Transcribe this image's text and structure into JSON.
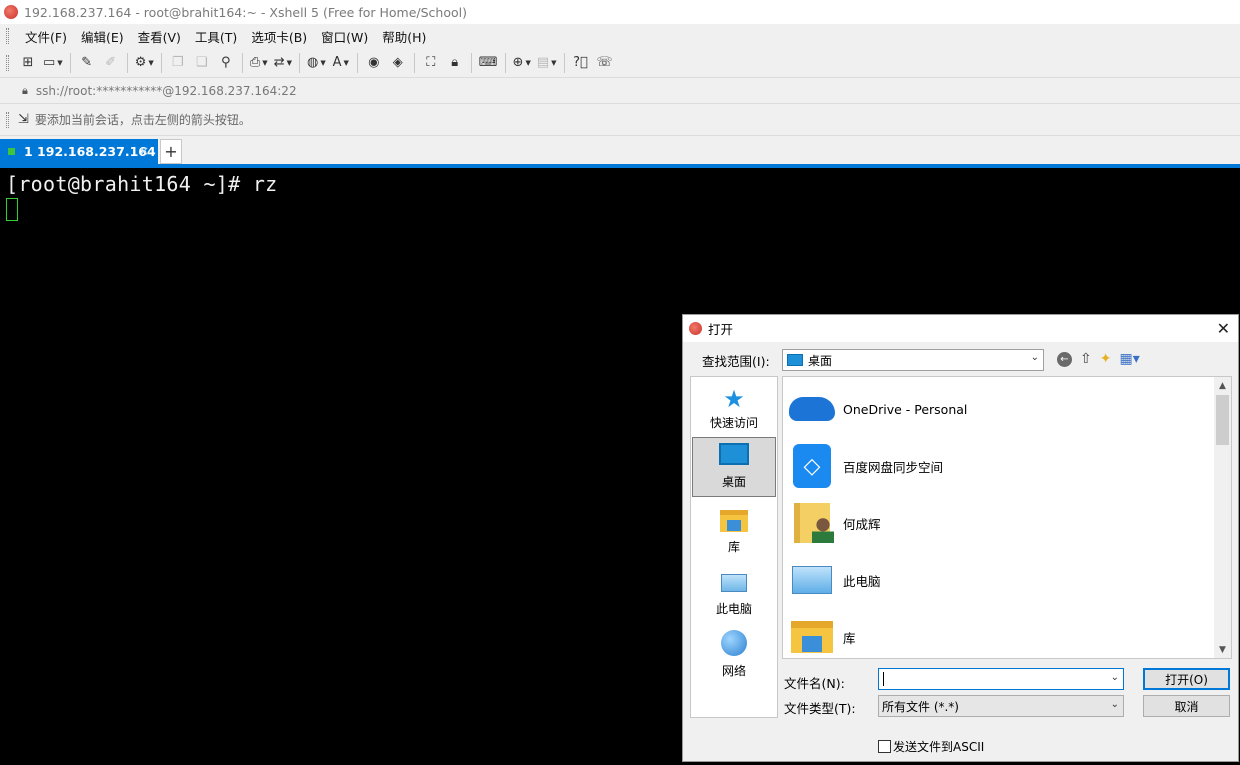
{
  "window": {
    "title": "192.168.237.164 - root@brahit164:~ - Xshell 5 (Free for Home/School)"
  },
  "menu": [
    {
      "label": "文件(F)"
    },
    {
      "label": "编辑(E)"
    },
    {
      "label": "查看(V)"
    },
    {
      "label": "工具(T)"
    },
    {
      "label": "选项卡(B)"
    },
    {
      "label": "窗口(W)"
    },
    {
      "label": "帮助(H)"
    }
  ],
  "toolbar": {
    "icons": [
      "new-session-icon",
      "open-folder-icon",
      "connect-icon",
      "disconnect-icon",
      "settings-icon",
      "copy-icon",
      "paste-icon",
      "find-icon",
      "print-icon",
      "transfer-icon",
      "globe-icon",
      "font-icon",
      "xftp-icon",
      "xmanager-icon",
      "fullscreen-icon",
      "lock-icon",
      "keyboard-icon",
      "add-icon",
      "layout-icon",
      "help-icon",
      "chat-icon"
    ]
  },
  "address": {
    "text": "ssh://root:***********@192.168.237.164:22"
  },
  "hint": {
    "text": "要添加当前会话，点击左侧的箭头按钮。"
  },
  "tabs": [
    {
      "label": "1 192.168.237.164",
      "close": "×"
    }
  ],
  "tab_add_label": "+",
  "terminal": {
    "prompt_line": "[root@brahit164 ~]# rz"
  },
  "dialog": {
    "title": "打开",
    "close": "✕",
    "look_in_label": "查找范围(I):",
    "look_in_value": "桌面",
    "places": [
      {
        "label": "快速访问",
        "icon": "star-icon"
      },
      {
        "label": "桌面",
        "icon": "desktop-icon",
        "selected": true
      },
      {
        "label": "库",
        "icon": "library-icon"
      },
      {
        "label": "此电脑",
        "icon": "computer-icon"
      },
      {
        "label": "网络",
        "icon": "network-icon"
      }
    ],
    "files": [
      {
        "name": "OneDrive - Personal",
        "icon": "onedrive-icon"
      },
      {
        "name": "百度网盘同步空间",
        "icon": "baidu-netdisk-icon"
      },
      {
        "name": "何成辉",
        "icon": "user-folder-icon"
      },
      {
        "name": "此电脑",
        "icon": "computer-icon"
      },
      {
        "name": "库",
        "icon": "library-icon"
      }
    ],
    "filename_label": "文件名(N):",
    "filename_value": "",
    "filetype_label": "文件类型(T):",
    "filetype_value": "所有文件 (*.*)",
    "open_button": "打开(O)",
    "cancel_button": "取消",
    "ascii_checkbox_label": "发送文件到ASCII",
    "ascii_checked": false
  }
}
